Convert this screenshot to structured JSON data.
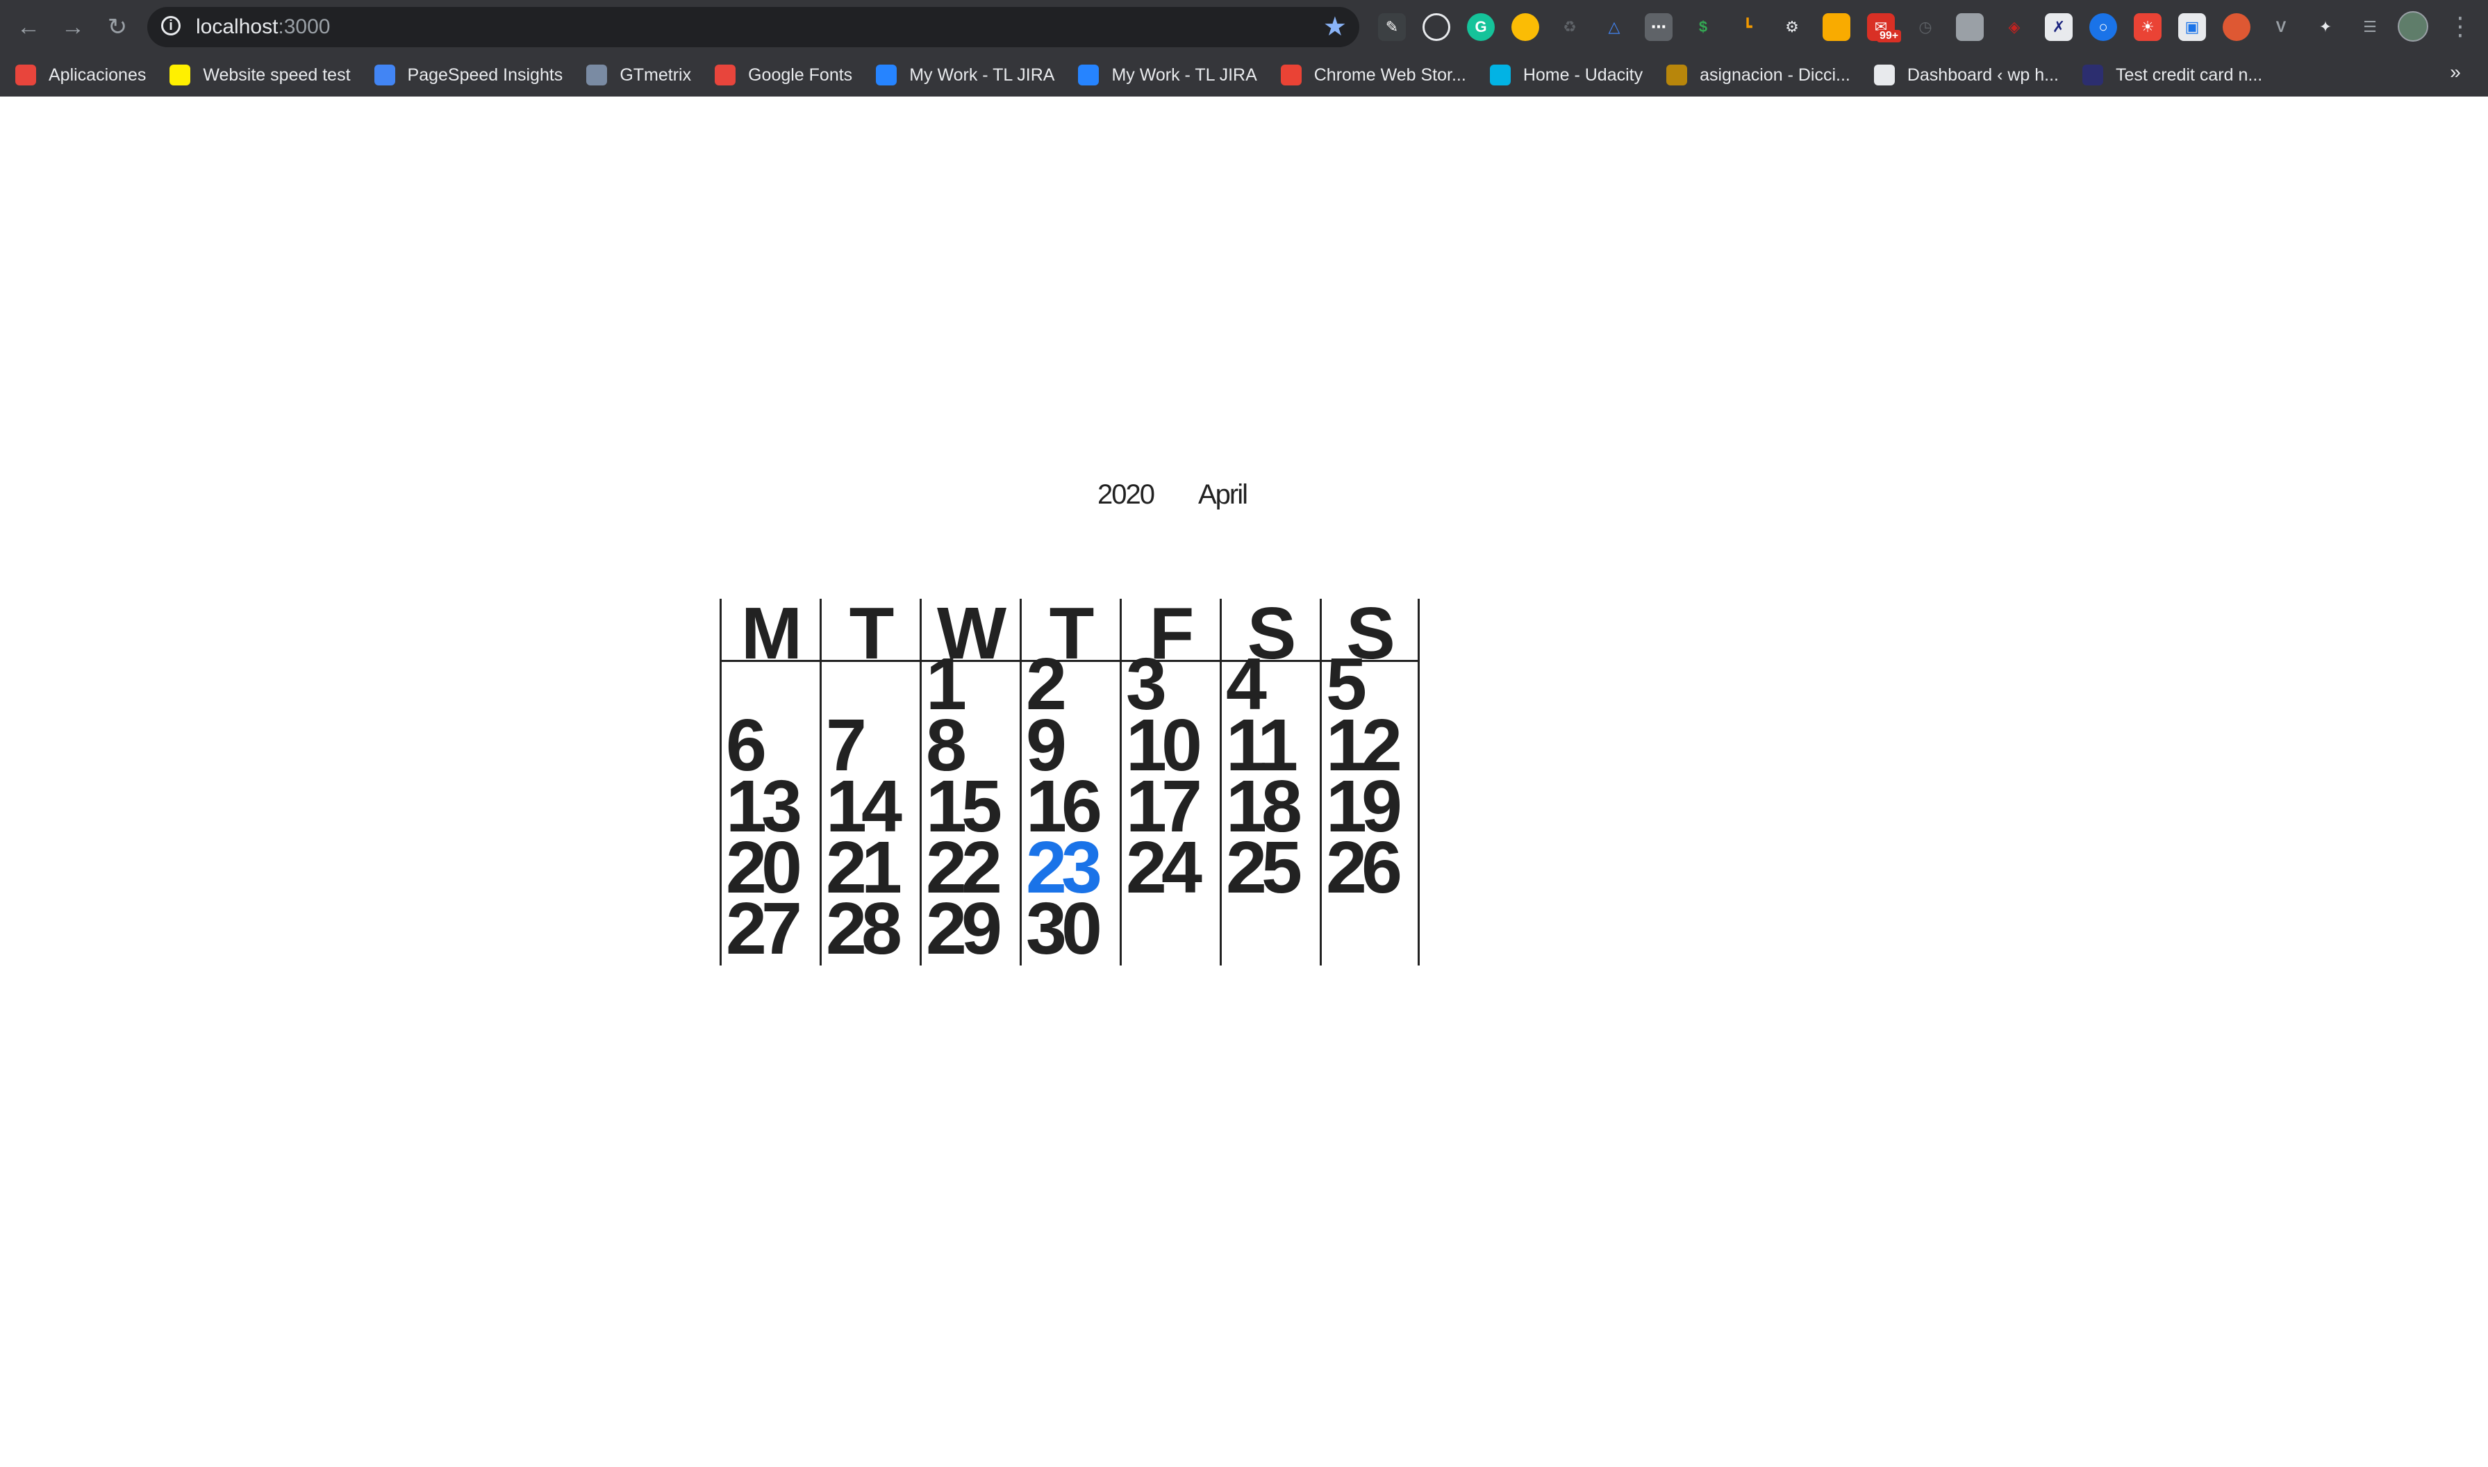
{
  "browser": {
    "url_host": "localhost",
    "url_port": ":3000",
    "bookmarks": [
      {
        "label": "Aplicaciones",
        "icon": "apps-grid-icon",
        "color": "#e8453c"
      },
      {
        "label": "Website speed test",
        "icon": "pingdom-icon",
        "color": "#fff000"
      },
      {
        "label": "PageSpeed Insights",
        "icon": "pagespeed-icon",
        "color": "#4285f4"
      },
      {
        "label": "GTmetrix",
        "icon": "gtmetrix-icon",
        "color": "#7a8ba3"
      },
      {
        "label": "Google Fonts",
        "icon": "google-fonts-icon",
        "color": "#e8453c"
      },
      {
        "label": "My Work - TL JIRA",
        "icon": "jira-icon",
        "color": "#2684ff"
      },
      {
        "label": "My Work - TL JIRA",
        "icon": "jira-icon",
        "color": "#2684ff"
      },
      {
        "label": "Chrome Web Stor...",
        "icon": "chrome-store-icon",
        "color": "#ea4335"
      },
      {
        "label": "Home - Udacity",
        "icon": "udacity-icon",
        "color": "#02b3e4"
      },
      {
        "label": "asignacion - Dicci...",
        "icon": "rae-icon",
        "color": "#b8860b"
      },
      {
        "label": "Dashboard ‹ wp h...",
        "icon": "globe-icon",
        "color": "#e8eaed"
      },
      {
        "label": "Test credit card n...",
        "icon": "paypal-icon",
        "color": "#2c2e6f"
      }
    ],
    "extension_badge": "99+"
  },
  "calendar": {
    "year": "2020",
    "month": "April",
    "weekdays": [
      "M",
      "T",
      "W",
      "T",
      "F",
      "S",
      "S"
    ],
    "columns": [
      {
        "days": [
          "6",
          "13",
          "20",
          "27"
        ],
        "first_row": 1
      },
      {
        "days": [
          "7",
          "14",
          "21",
          "28"
        ],
        "first_row": 1
      },
      {
        "days": [
          "1",
          "8",
          "15",
          "22",
          "29"
        ],
        "first_row": 0
      },
      {
        "days": [
          "2",
          "9",
          "16",
          "23",
          "30"
        ],
        "first_row": 0
      },
      {
        "days": [
          "3",
          "10",
          "17",
          "24"
        ],
        "first_row": 0
      },
      {
        "days": [
          "4",
          "11",
          "18",
          "25"
        ],
        "first_row": 0
      },
      {
        "days": [
          "5",
          "12",
          "19",
          "26"
        ],
        "first_row": 0
      }
    ],
    "today": "23",
    "today_color": "#1a73e8"
  }
}
